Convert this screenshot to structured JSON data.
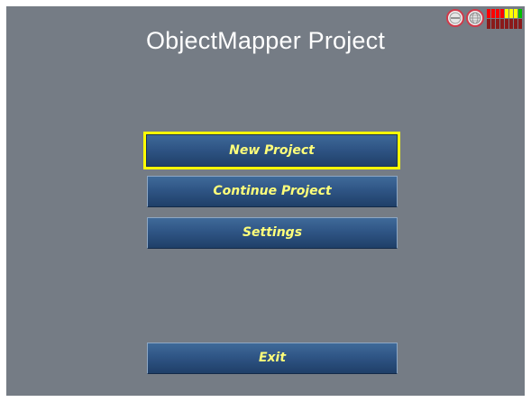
{
  "app": {
    "title": "ObjectMapper Project"
  },
  "status": {
    "icons": [
      "minus-indicator-icon",
      "globe-indicator-icon",
      "signal-strength-icon"
    ],
    "signal_colors": [
      "#ff0000",
      "#ff0000",
      "#ff0000",
      "#ff0000",
      "#ffff00",
      "#ffff00",
      "#ffff00",
      "#00c000"
    ]
  },
  "menu": {
    "new_project": "New Project",
    "continue_project": "Continue Project",
    "settings": "Settings",
    "exit": "Exit",
    "selected": "New Project"
  },
  "colors": {
    "background": "#757c85",
    "button_text": "#ffff7a",
    "selection_border": "#ffff00"
  }
}
